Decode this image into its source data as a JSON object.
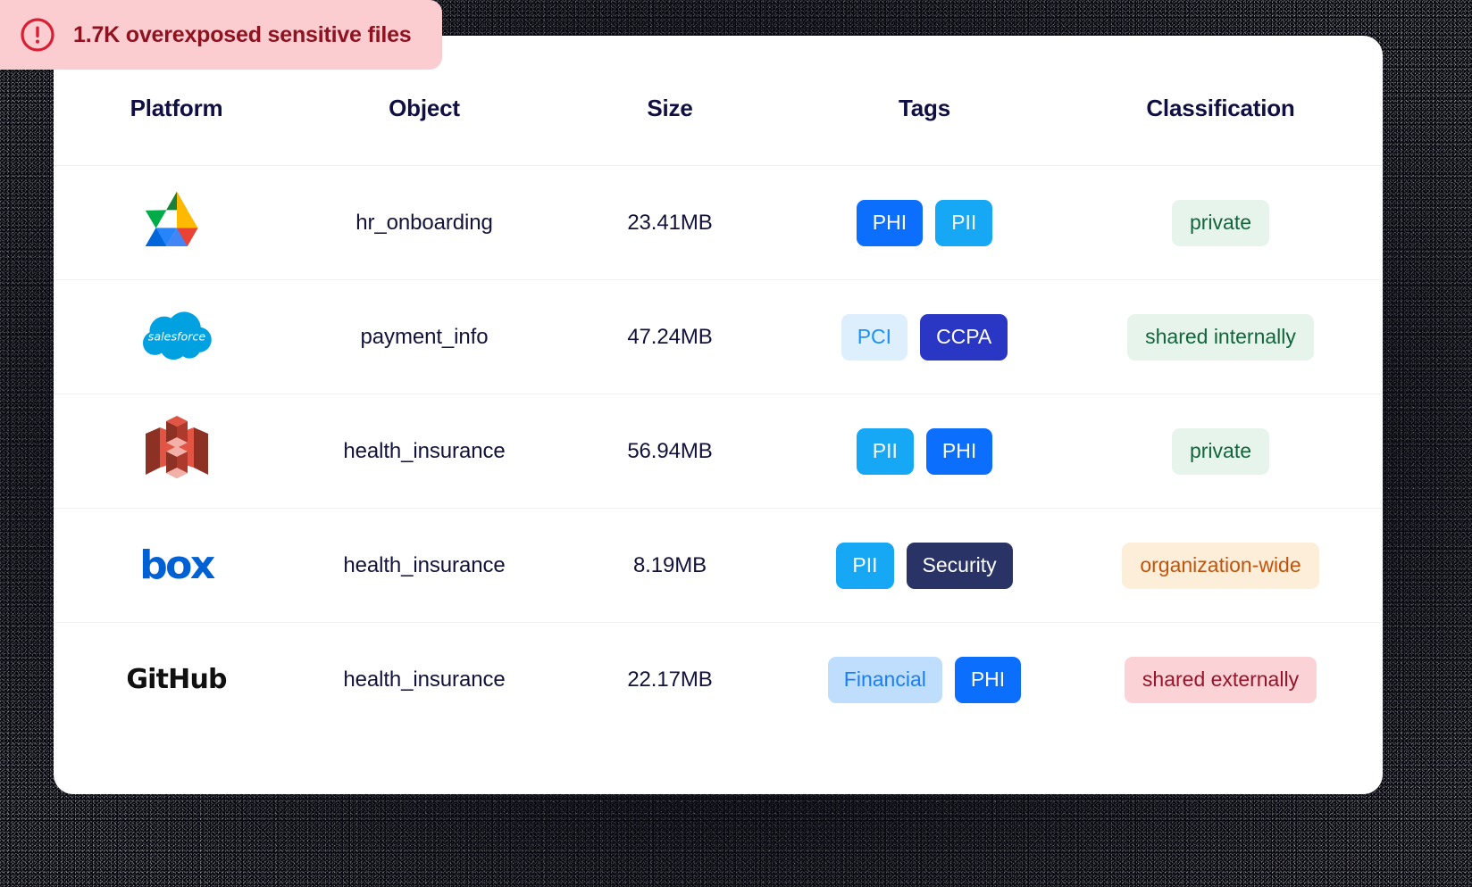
{
  "alert": {
    "icon": "alert-circle-icon",
    "text": "1.7K overexposed sensitive files",
    "bg_color": "#fbcdd0",
    "text_color": "#8f1220"
  },
  "table": {
    "headers": {
      "platform": "Platform",
      "object": "Object",
      "size": "Size",
      "tags": "Tags",
      "classification": "Classification"
    },
    "rows": [
      {
        "platform": "Google Drive",
        "platform_icon": "google-drive-icon",
        "object": "hr_onboarding",
        "size": "23.41MB",
        "tags": [
          {
            "label": "PHI",
            "bg": "#0b6efd",
            "fg": "#ffffff"
          },
          {
            "label": "PII",
            "bg": "#17a8f5",
            "fg": "#ffffff"
          }
        ],
        "classification": {
          "label": "private",
          "bg": "#e6f4ec",
          "fg": "#12653a"
        }
      },
      {
        "platform": "Salesforce",
        "platform_icon": "salesforce-icon",
        "object": "payment_info",
        "size": "47.24MB",
        "tags": [
          {
            "label": "PCI",
            "bg": "#ddeffd",
            "fg": "#1a92f5"
          },
          {
            "label": "CCPA",
            "bg": "#2a36c4",
            "fg": "#ffffff"
          }
        ],
        "classification": {
          "label": "shared internally",
          "bg": "#e6f4ec",
          "fg": "#12653a"
        }
      },
      {
        "platform": "Amazon S3",
        "platform_icon": "aws-s3-icon",
        "object": "health_insurance",
        "size": "56.94MB",
        "tags": [
          {
            "label": "PII",
            "bg": "#17a8f5",
            "fg": "#ffffff"
          },
          {
            "label": "PHI",
            "bg": "#0b6efd",
            "fg": "#ffffff"
          }
        ],
        "classification": {
          "label": "private",
          "bg": "#e6f4ec",
          "fg": "#12653a"
        }
      },
      {
        "platform": "Box",
        "platform_icon": "box-icon",
        "object": "health_insurance",
        "size": "8.19MB",
        "tags": [
          {
            "label": "PII",
            "bg": "#17a8f5",
            "fg": "#ffffff"
          },
          {
            "label": "Security",
            "bg": "#2a3365",
            "fg": "#ffffff"
          }
        ],
        "classification": {
          "label": "organization-wide",
          "bg": "#fdeeda",
          "fg": "#c2530c"
        }
      },
      {
        "platform": "GitHub",
        "platform_icon": "github-icon",
        "platform_wordmark": "GitHub",
        "object": "health_insurance",
        "size": "22.17MB",
        "tags": [
          {
            "label": "Financial",
            "bg": "#bfdefd",
            "fg": "#1a7ef5"
          },
          {
            "label": "PHI",
            "bg": "#0b6efd",
            "fg": "#ffffff"
          }
        ],
        "classification": {
          "label": "shared externally",
          "bg": "#fbd3d6",
          "fg": "#97142a"
        }
      }
    ]
  },
  "logos": {
    "salesforce_wordmark": "salesforce",
    "box_wordmark": "box"
  }
}
